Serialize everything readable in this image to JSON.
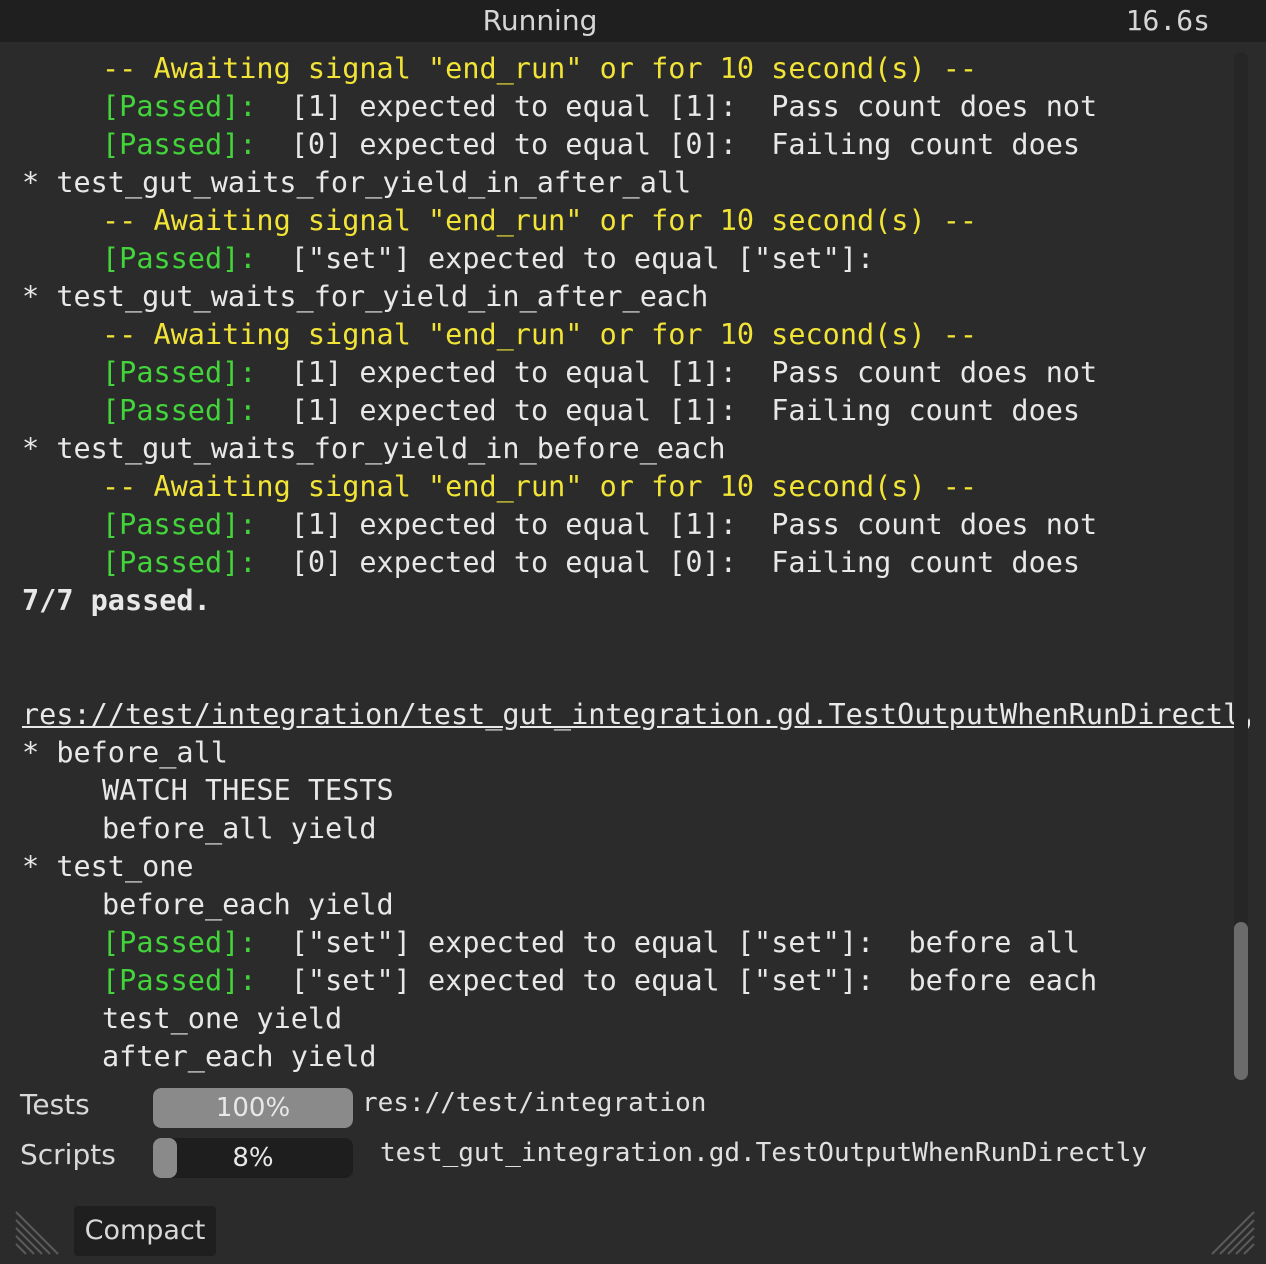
{
  "titlebar": {
    "title": "Running",
    "elapsed": "16.6s"
  },
  "output": {
    "lines": [
      {
        "style": "await",
        "text": "-- Awaiting signal \"end_run\" or for 10 second(s) --"
      },
      {
        "style": "pass",
        "tag": "[Passed]:",
        "text": "  [1] expected to equal [1]:  Pass count does not"
      },
      {
        "style": "pass",
        "tag": "[Passed]:",
        "text": "  [0] expected to equal [0]:  Failing count does"
      },
      {
        "style": "test",
        "text": "* test_gut_waits_for_yield_in_after_all"
      },
      {
        "style": "await",
        "text": "-- Awaiting signal \"end_run\" or for 10 second(s) --"
      },
      {
        "style": "pass",
        "tag": "[Passed]:",
        "text": "  [\"set\"] expected to equal [\"set\"]:"
      },
      {
        "style": "test",
        "text": "* test_gut_waits_for_yield_in_after_each"
      },
      {
        "style": "await",
        "text": "-- Awaiting signal \"end_run\" or for 10 second(s) --"
      },
      {
        "style": "pass",
        "tag": "[Passed]:",
        "text": "  [1] expected to equal [1]:  Pass count does not"
      },
      {
        "style": "pass",
        "tag": "[Passed]:",
        "text": "  [1] expected to equal [1]:  Failing count does"
      },
      {
        "style": "test",
        "text": "* test_gut_waits_for_yield_in_before_each"
      },
      {
        "style": "await",
        "text": "-- Awaiting signal \"end_run\" or for 10 second(s) --"
      },
      {
        "style": "pass",
        "tag": "[Passed]:",
        "text": "  [1] expected to equal [1]:  Pass count does not"
      },
      {
        "style": "pass",
        "tag": "[Passed]:",
        "text": "  [0] expected to equal [0]:  Failing count does"
      },
      {
        "style": "summary",
        "text": "7/7 passed."
      },
      {
        "style": "blank",
        "text": ""
      },
      {
        "style": "blank",
        "text": ""
      },
      {
        "style": "script",
        "text": "res://test/integration/test_gut_integration.gd.TestOutputWhenRunDirectly"
      },
      {
        "style": "test",
        "text": "* before_all"
      },
      {
        "style": "info",
        "text": "WATCH THESE TESTS"
      },
      {
        "style": "info",
        "text": "before_all yield"
      },
      {
        "style": "test",
        "text": "* test_one"
      },
      {
        "style": "info",
        "text": "before_each yield"
      },
      {
        "style": "pass",
        "tag": "[Passed]:",
        "text": "  [\"set\"] expected to equal [\"set\"]:  before all"
      },
      {
        "style": "pass",
        "tag": "[Passed]:",
        "text": "  [\"set\"] expected to equal [\"set\"]:  before each"
      },
      {
        "style": "info",
        "text": "test_one yield"
      },
      {
        "style": "info",
        "text": "after_each yield"
      }
    ]
  },
  "progress": {
    "tests": {
      "label": "Tests",
      "percent_text": "100%",
      "fraction": 1.0,
      "path": "res://test/integration"
    },
    "scripts": {
      "label": "Scripts",
      "percent_text": "8%",
      "fraction": 0.08,
      "path": "test_gut_integration.gd.TestOutputWhenRunDirectly"
    }
  },
  "footer": {
    "compact_label": "Compact"
  },
  "colors": {
    "await": "#f2e436",
    "passed": "#42d43a",
    "text": "#e8e8e8",
    "background": "#2b2b2b"
  }
}
